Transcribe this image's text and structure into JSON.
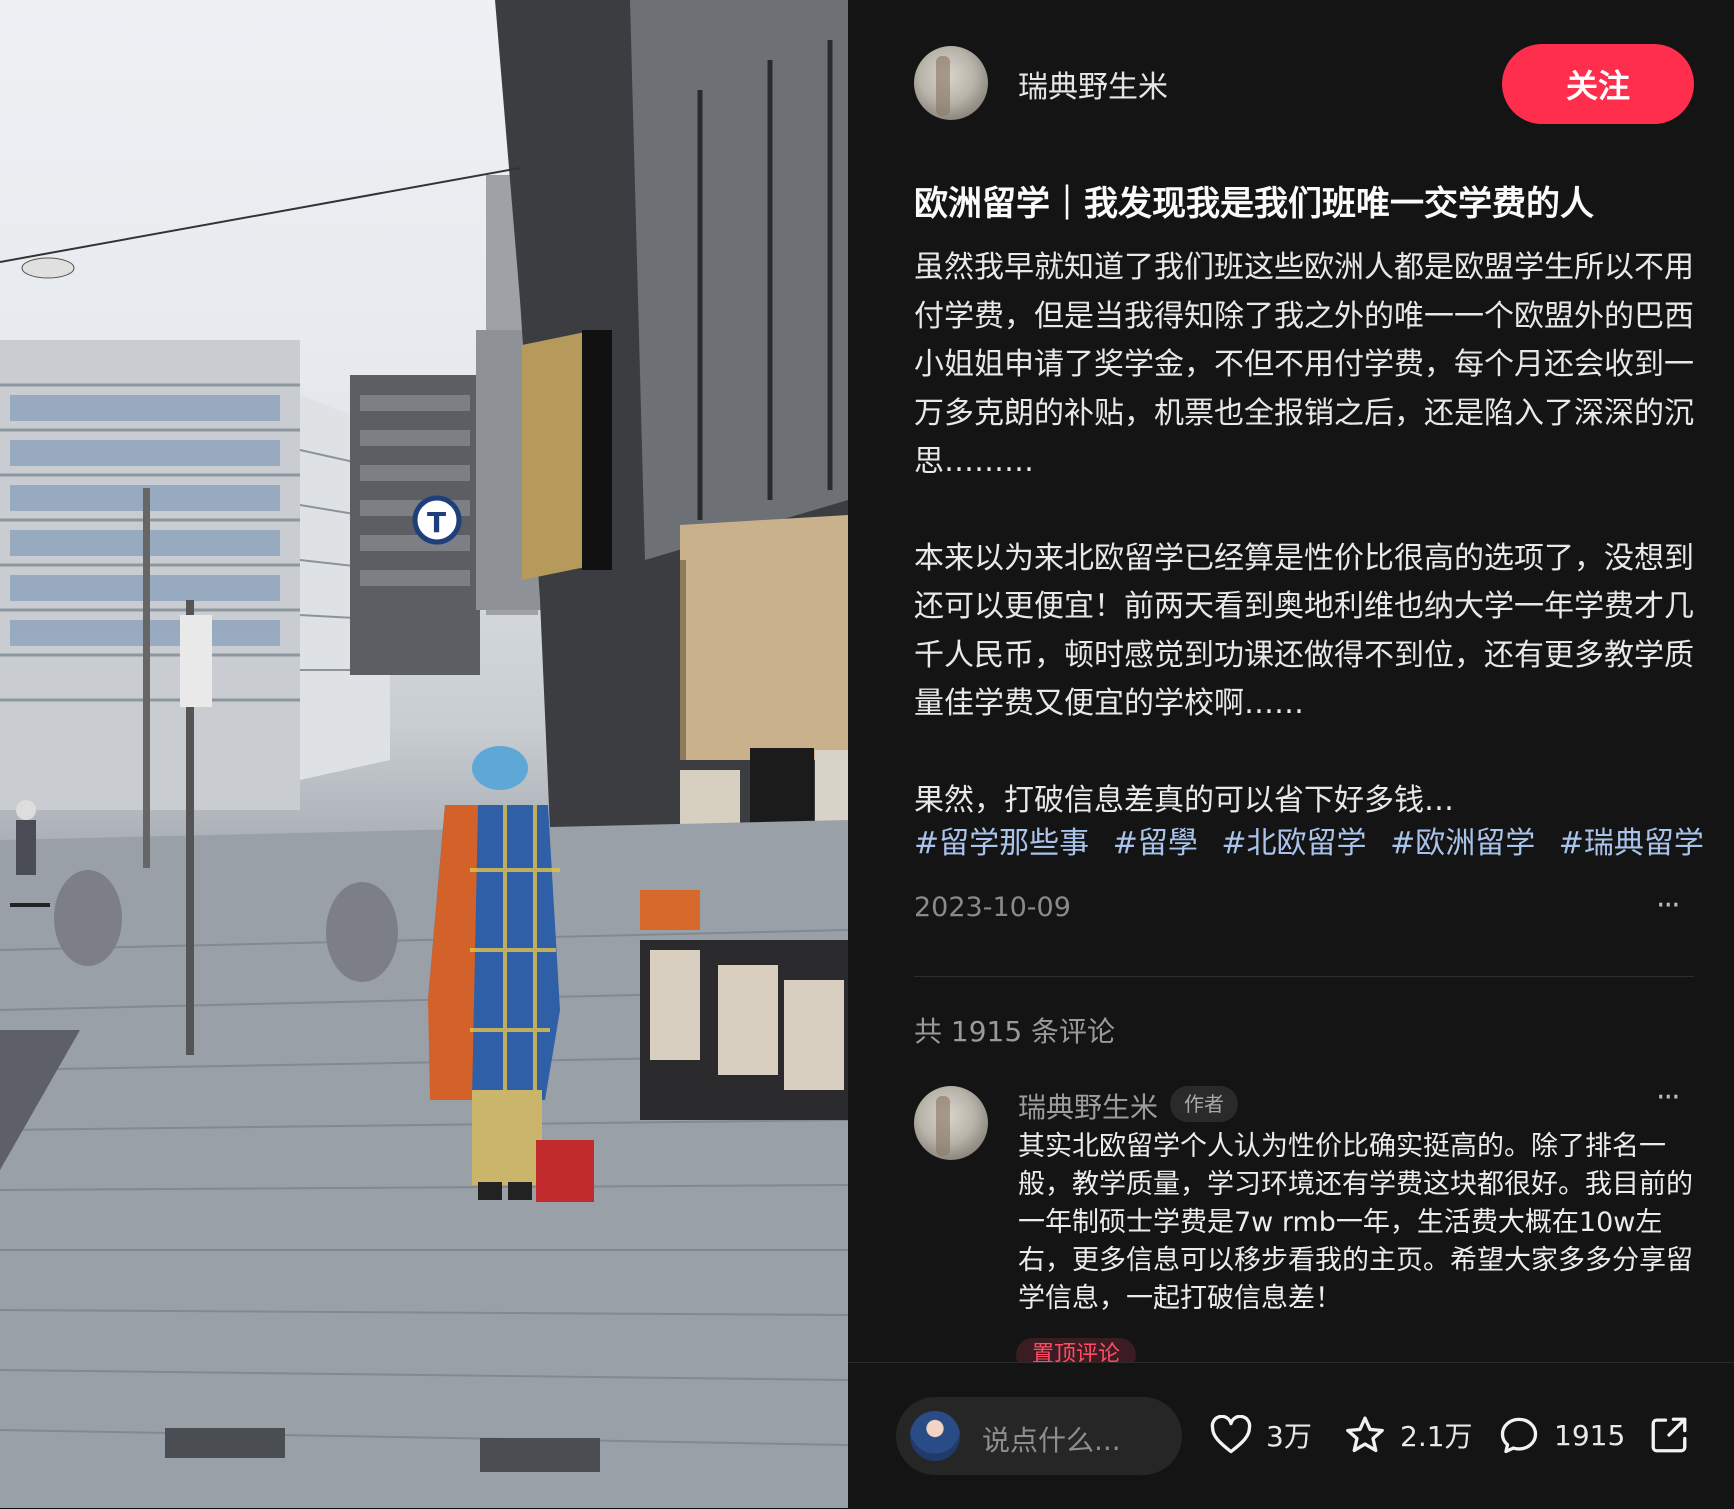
{
  "author": {
    "name": "瑞典野生米",
    "follow_label": "关注"
  },
  "post": {
    "title": "欧洲留学｜我发现我是我们班唯一交学费的人",
    "paragraphs": [
      "虽然我早就知道了我们班这些欧洲人都是欧盟学生所以不用付学费，但是当我得知除了我之外的唯一一个欧盟外的巴西小姐姐申请了奖学金，不但不用付学费，每个月还会收到一万多克朗的补贴，机票也全报销之后，还是陷入了深深的沉思………",
      "本来以为来北欧留学已经算是性价比很高的选项了，没想到还可以更便宜！前两天看到奥地利维也纳大学一年学费才几千人民币，顿时感觉到功课还做得不到位，还有更多教学质量佳学费又便宜的学校啊……",
      "果然，打破信息差真的可以省下好多钱…"
    ],
    "tags": [
      "#留学那些事",
      "#留學",
      "#北欧留学",
      "#欧洲留学",
      "#瑞典留学"
    ],
    "date": "2023-10-09",
    "more_label": "···"
  },
  "comments": {
    "count_label": "共 1915 条评论",
    "items": [
      {
        "name": "瑞典野生米",
        "badge": "作者",
        "more_label": "···",
        "text": "其实北欧留学个人认为性价比确实挺高的。除了排名一般，教学质量，学习环境还有学费这块都很好。我目前的一年制硕士学费是7w rmb一年，生活费大概在10w左右，更多信息可以移步看我的主页。希望大家多多分享留学信息，一起打破信息差！",
        "pin_label": "置顶评论"
      }
    ]
  },
  "bottom_bar": {
    "input_placeholder": "说点什么...",
    "likes": "3万",
    "stars": "2.1万",
    "comments": "1915"
  },
  "colors": {
    "accent": "#ff2e4d",
    "tag": "#a9c3ea",
    "background": "#141414"
  }
}
